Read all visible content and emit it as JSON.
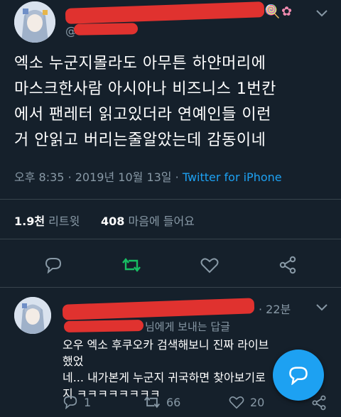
{
  "tweet": {
    "display_name": "",
    "handle": "@",
    "body_lines": [
      "엑소 누군지몰라도 아무튼 하얀머리에",
      "마스크한사람 아시아나 비즈니스 1번칸",
      "에서 팬레터 읽고있더라 연예인들 이런",
      "거 안읽고 버리는줄알았는데 감동이네"
    ],
    "time": "오후 8:35",
    "date": "2019년 10월 13일",
    "sep": "·",
    "source": "Twitter for iPhone",
    "retweets_count": "1.9천",
    "retweets_label": "리트윗",
    "likes_count": "408",
    "likes_label": "마음에 들어요"
  },
  "reply": {
    "time_ago": "22분",
    "replying_to_suffix": "님에게 보내는 답글",
    "body_lines": [
      "오우 엑소 후쿠오카 검색해보니 진짜 라이브했었",
      "네... 내가본게 누군지 귀국하면 찾아보기로",
      "지 ㅋㅋㅋㅋㅋㅋㅋㅋ"
    ],
    "reply_count": "1",
    "retweet_count": "66",
    "like_count": "20"
  },
  "colors": {
    "background": "#15202b",
    "text": "#ffffff",
    "muted": "#8899a6",
    "link": "#1da1f2",
    "retweet_green": "#17bf63",
    "divider": "#38444d"
  },
  "icons": [
    "reply-icon",
    "retweet-icon",
    "like-icon",
    "share-icon",
    "compose-reply-icon",
    "chevron-down-icon"
  ]
}
